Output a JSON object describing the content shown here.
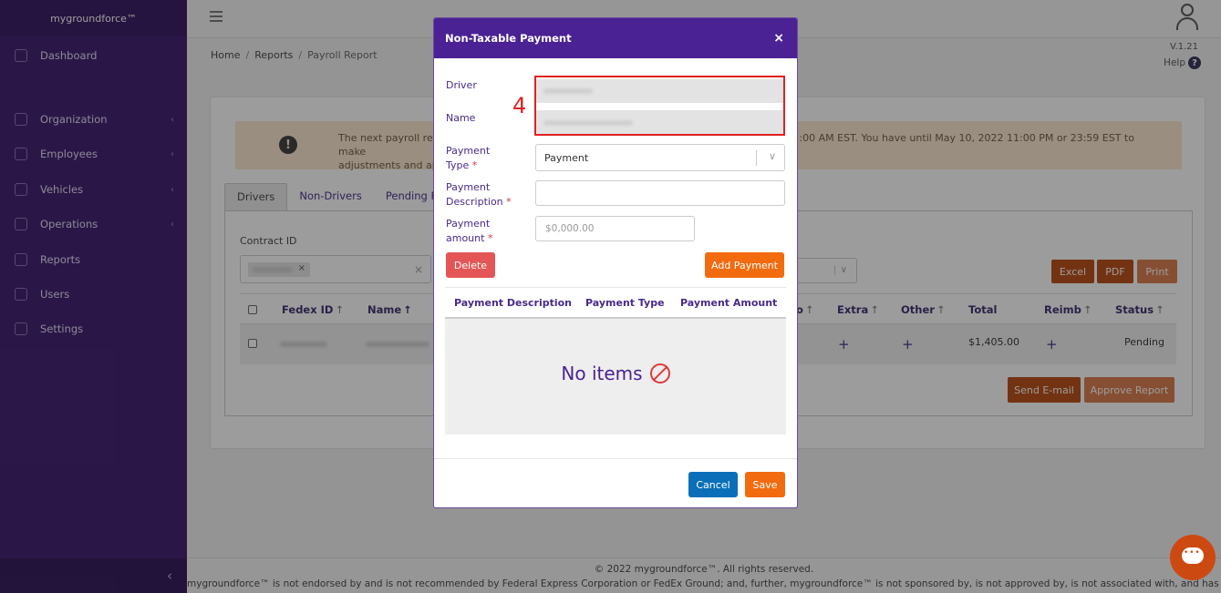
{
  "app": {
    "brand": "mygroundforce™"
  },
  "sidebar": {
    "items": [
      {
        "label": "Dashboard",
        "icon": "dashboard-icon",
        "has_submenu": false
      },
      {
        "label": "Organization",
        "icon": "organization-icon",
        "has_submenu": true
      },
      {
        "label": "Employees",
        "icon": "employees-icon",
        "has_submenu": true
      },
      {
        "label": "Vehicles",
        "icon": "truck-icon",
        "has_submenu": true
      },
      {
        "label": "Operations",
        "icon": "calendar-icon",
        "has_submenu": true
      },
      {
        "label": "Reports",
        "icon": "chart-icon",
        "has_submenu": false
      },
      {
        "label": "Users",
        "icon": "users-icon",
        "has_submenu": false
      },
      {
        "label": "Settings",
        "icon": "gear-icon",
        "has_submenu": false
      }
    ],
    "submenu_chevron": "‹",
    "collapse_glyph": "‹"
  },
  "header": {
    "version": "V.1.21",
    "help_label": "Help",
    "help_glyph": "?"
  },
  "breadcrumb": {
    "home": "Home",
    "reports": "Reports",
    "current": "Payroll Report",
    "separator": "/"
  },
  "alert": {
    "icon_glyph": "!",
    "text_visible_left": "The next payroll repo",
    "text_visible_right": ":00 AM EST. You have until May 10, 2022 11:00 PM or 23:59 EST to make",
    "text_line2": "adjustments and app"
  },
  "tabs": [
    {
      "label": "Drivers",
      "active": true
    },
    {
      "label": "Non-Drivers",
      "active": false
    },
    {
      "label": "Pending Payro",
      "active": false
    }
  ],
  "filters": {
    "contract_label": "Contract ID",
    "chip_remove": "×",
    "clear_glyph": "×",
    "dropdown_glyph": "∨"
  },
  "actions": {
    "excel": "Excel",
    "pdf": "PDF",
    "print": "Print",
    "send_email": "Send E-mail",
    "approve_report": "Approve Report"
  },
  "table": {
    "sort_glyph": "↑",
    "columns": {
      "fedex_id": "Fedex ID",
      "name": "Name",
      "partial": "o",
      "extra": "Extra",
      "other": "Other",
      "total": "Total",
      "reimb": "Reimb",
      "status": "Status"
    },
    "rows": [
      {
        "total": "$1,405.00",
        "status": "Pending",
        "add_glyph": "+"
      }
    ]
  },
  "footer": {
    "copyright": "© 2022 mygroundforce™. All rights reserved.",
    "disclaimer": "mygroundforce™ is not endorsed by and is not recommended by Federal Express Corporation or FedEx Ground; and, further, mygroundforce™ is not sponsored by, is not approved by, is not associated with, and has no"
  },
  "modal": {
    "title": "Non-Taxable Payment",
    "close_glyph": "×",
    "driver_label": "Driver",
    "name_label": "Name",
    "annotation_number": "4",
    "payment_type_label_1": "Payment",
    "payment_type_label_2": "Type",
    "payment_type_value": "Payment",
    "payment_desc_label_1": "Payment",
    "payment_desc_label_2": "Description",
    "payment_amount_label_1": "Payment",
    "payment_amount_label_2": "amount",
    "required_marker": "*",
    "amount_placeholder": "$0,000.00",
    "chevron_glyph": "∨",
    "delete_label": "Delete",
    "add_payment_label": "Add Payment",
    "columns": {
      "description": "Payment Description",
      "type": "Payment Type",
      "amount": "Payment Amount"
    },
    "empty_text": "No items",
    "cancel_label": "Cancel",
    "save_label": "Save"
  },
  "colors": {
    "sidebar_bg": "#3b1a6e",
    "modal_header": "#4b2293",
    "accent_orange": "#f26b0f",
    "cancel_blue": "#0a6fb8",
    "delete_red": "#e45656",
    "annotation_red": "#e02020",
    "action_brown": "#b94a14"
  }
}
